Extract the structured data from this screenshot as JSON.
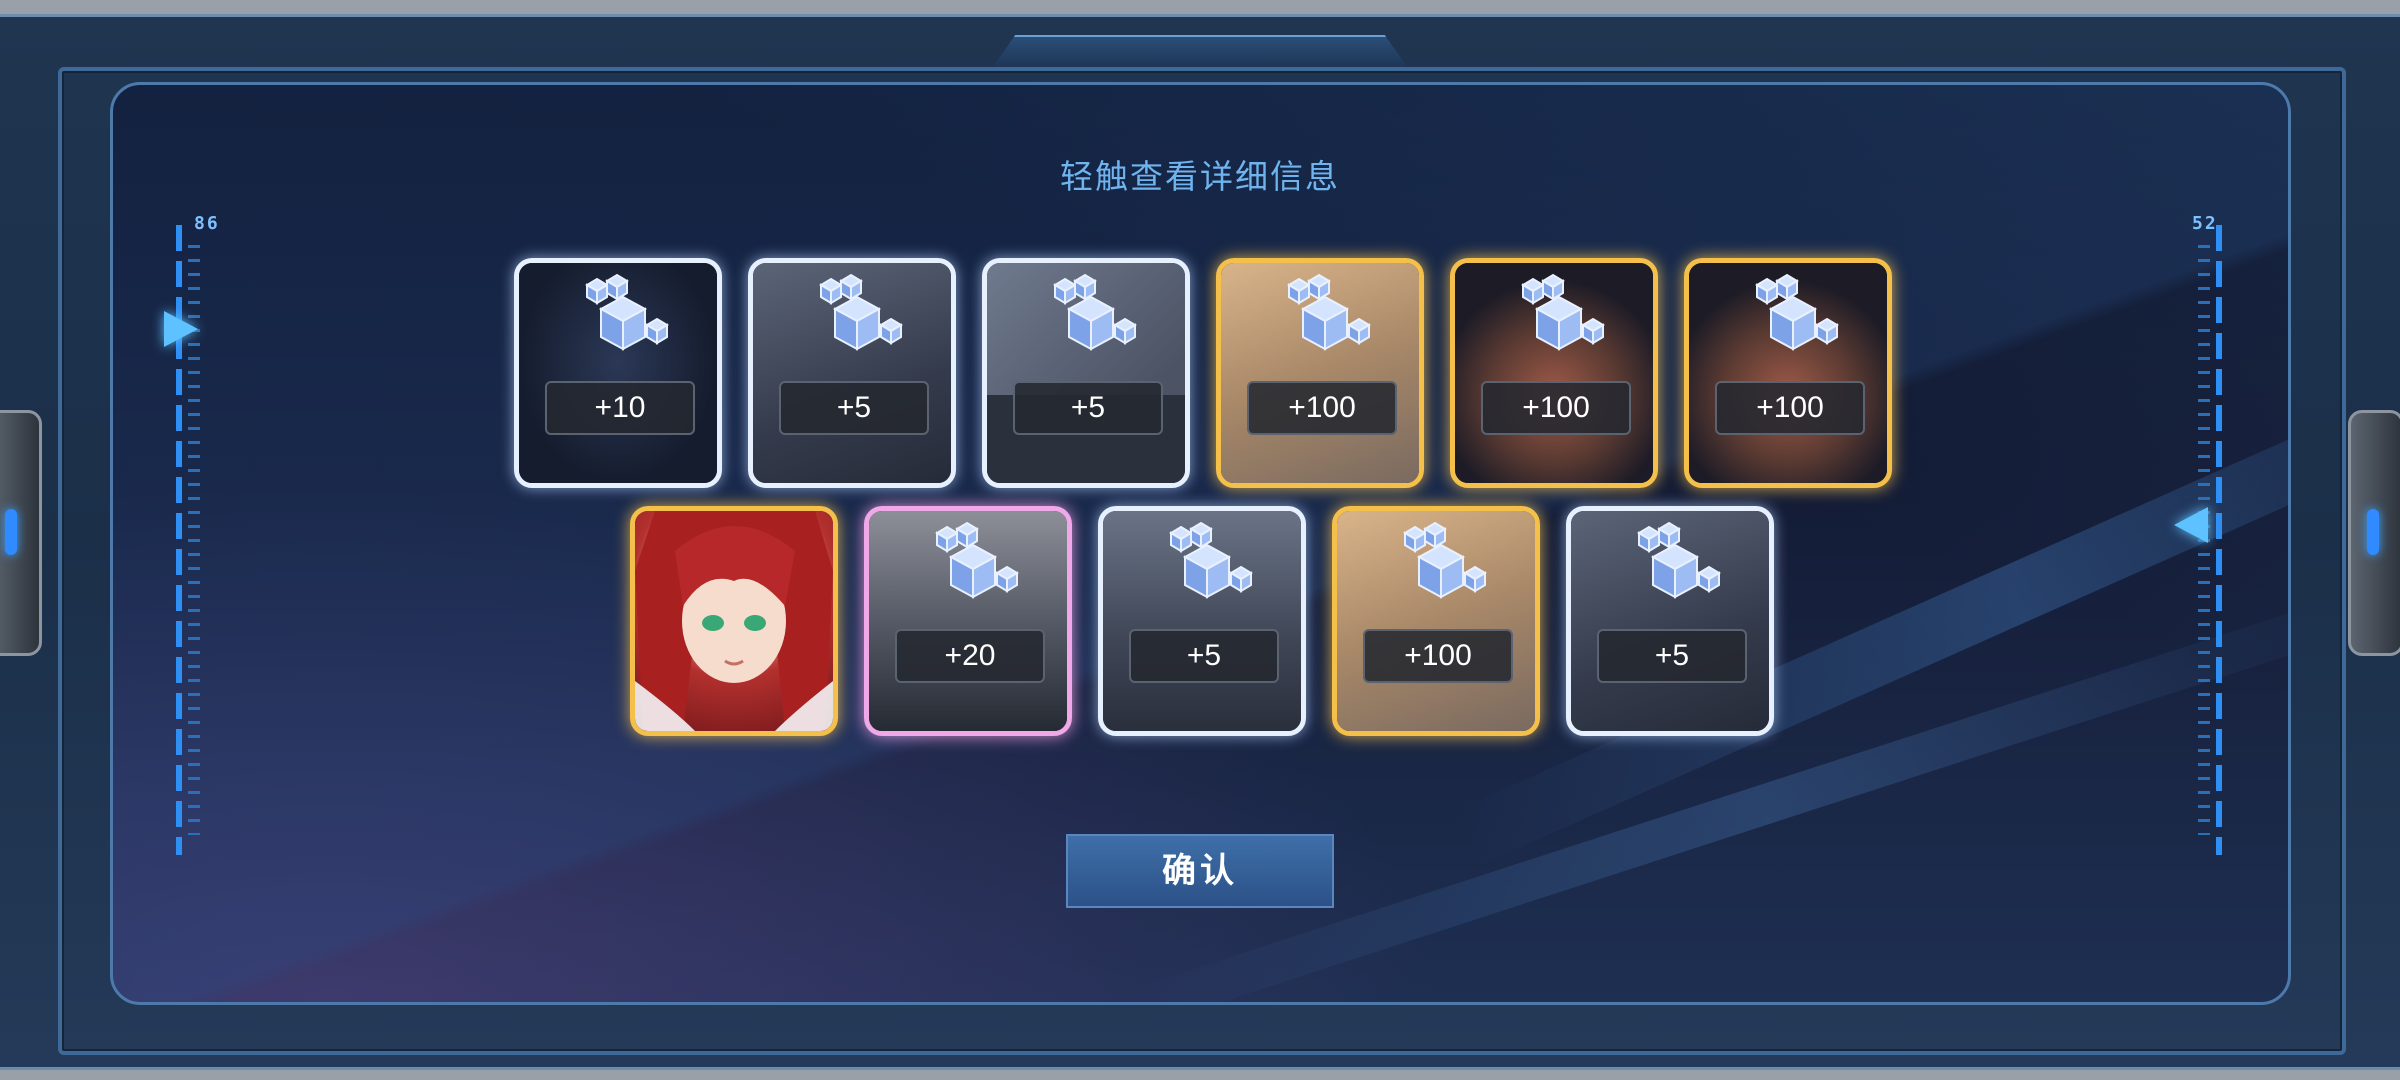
{
  "header": {
    "hint": "轻触查看详细信息"
  },
  "gauges": {
    "left_value": "86",
    "right_value": "52"
  },
  "rewards": {
    "row1": [
      {
        "quantity": "+10",
        "icon": "cube-icon",
        "rarity": "white"
      },
      {
        "quantity": "+5",
        "icon": "cube-icon",
        "rarity": "white"
      },
      {
        "quantity": "+5",
        "icon": "cube-icon",
        "rarity": "white"
      },
      {
        "quantity": "+100",
        "icon": "cube-icon",
        "rarity": "gold"
      },
      {
        "quantity": "+100",
        "icon": "cube-icon",
        "rarity": "gold"
      },
      {
        "quantity": "+100",
        "icon": "cube-icon",
        "rarity": "gold"
      }
    ],
    "row2": [
      {
        "quantity": "",
        "icon": "character-portrait",
        "rarity": "gold"
      },
      {
        "quantity": "+20",
        "icon": "cube-icon",
        "rarity": "pink"
      },
      {
        "quantity": "+5",
        "icon": "cube-icon",
        "rarity": "white"
      },
      {
        "quantity": "+100",
        "icon": "cube-icon",
        "rarity": "gold"
      },
      {
        "quantity": "+5",
        "icon": "cube-icon",
        "rarity": "white"
      }
    ]
  },
  "footer": {
    "confirm_label": "确认"
  },
  "colors": {
    "gold": "#f5c04a",
    "white": "#e6f0ff",
    "pink": "#f0a8e8",
    "accent": "#6fb4ee",
    "button": "#3f6fa8"
  }
}
